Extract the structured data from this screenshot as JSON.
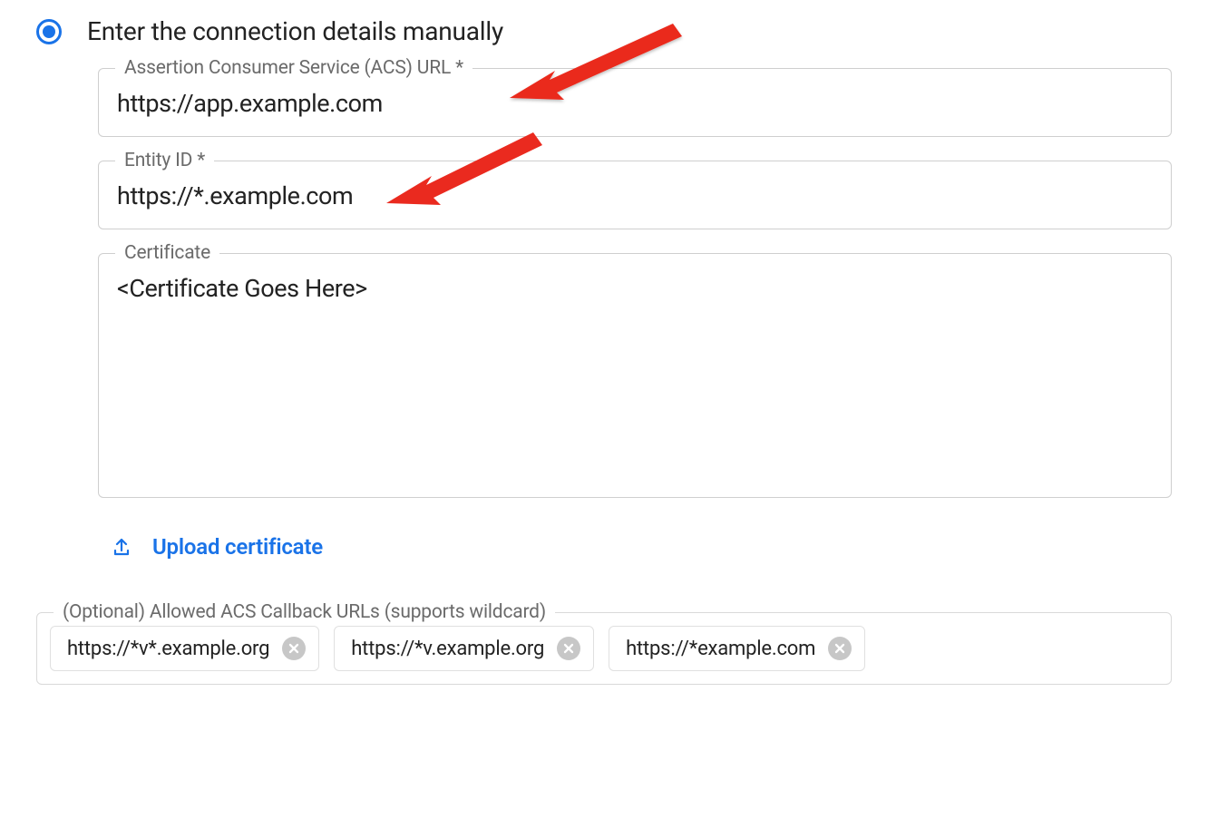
{
  "radio": {
    "label": "Enter the connection details manually"
  },
  "fields": {
    "acs": {
      "label": "Assertion Consumer Service (ACS) URL *",
      "value": "https://app.example.com"
    },
    "entity": {
      "label": "Entity ID *",
      "value": "https://*.example.com"
    },
    "certificate": {
      "label": "Certificate",
      "value": "<Certificate Goes Here>"
    }
  },
  "upload": {
    "label": "Upload certificate"
  },
  "callbacks": {
    "label": "(Optional) Allowed ACS Callback URLs (supports wildcard)",
    "chips": [
      "https://*v*.example.org",
      "https://*v.example.org",
      "https://*example.com"
    ]
  },
  "colors": {
    "accent": "#1a73e8",
    "arrow": "#ea2a1f"
  }
}
